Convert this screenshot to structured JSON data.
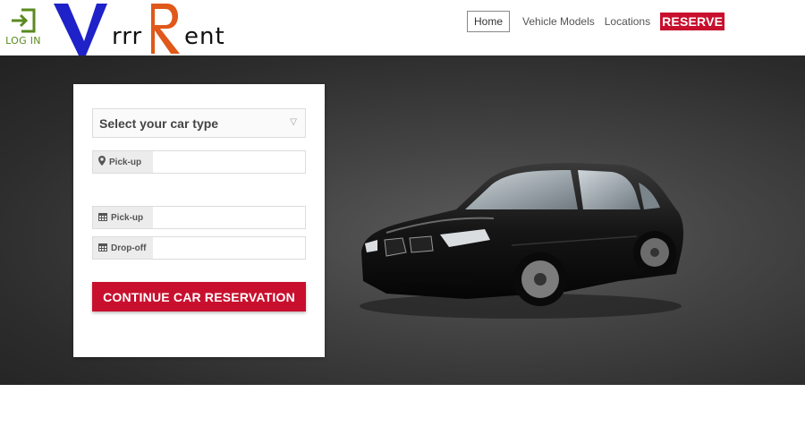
{
  "header": {
    "login_label": "LOG IN",
    "logo": {
      "text_part1": "rrr",
      "text_part2": "ent",
      "color_v": "#1e22c8",
      "color_r": "#e0581a"
    },
    "nav": {
      "home": "Home",
      "vehicle_models": "Vehicle Models",
      "locations": "Locations",
      "reserve": "RESERVE"
    }
  },
  "form": {
    "car_type_placeholder": "Select your car type",
    "pickup_location_label": "Pick-up",
    "pickup_date_label": "Pick-up",
    "dropoff_date_label": "Drop-off",
    "pickup_location_value": "",
    "pickup_date_value": "",
    "dropoff_date_value": "",
    "continue_label": "CONTINUE CAR RESERVATION"
  },
  "colors": {
    "accent": "#c8102e",
    "login_green": "#5a8a1f"
  }
}
